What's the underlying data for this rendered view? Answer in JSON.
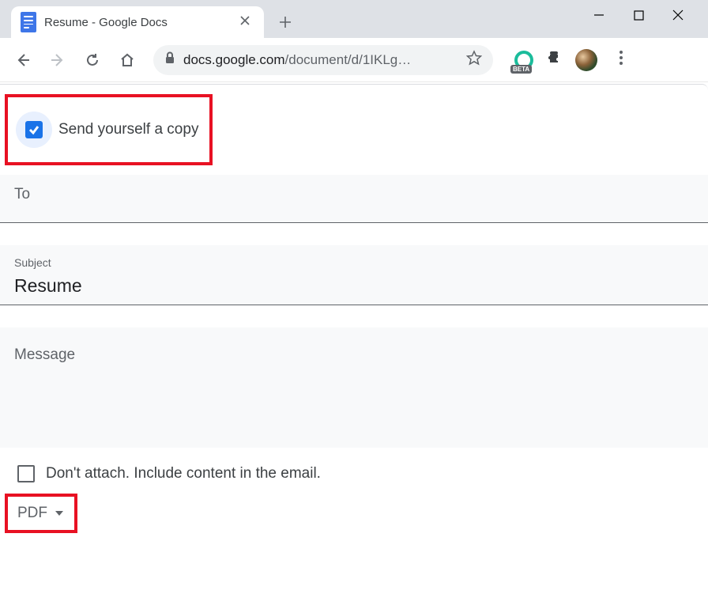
{
  "browser": {
    "tab_title": "Resume - Google Docs",
    "url_domain": "docs.google.com",
    "url_path": "/document/d/1IKLg…",
    "beta_badge": "BETA"
  },
  "dialog": {
    "send_copy_label": "Send yourself a copy",
    "send_copy_checked": true,
    "to_label": "To",
    "subject_label": "Subject",
    "subject_value": "Resume",
    "message_label": "Message",
    "dont_attach_label": "Don't attach. Include content in the email.",
    "dont_attach_checked": false,
    "format_selected": "PDF"
  }
}
